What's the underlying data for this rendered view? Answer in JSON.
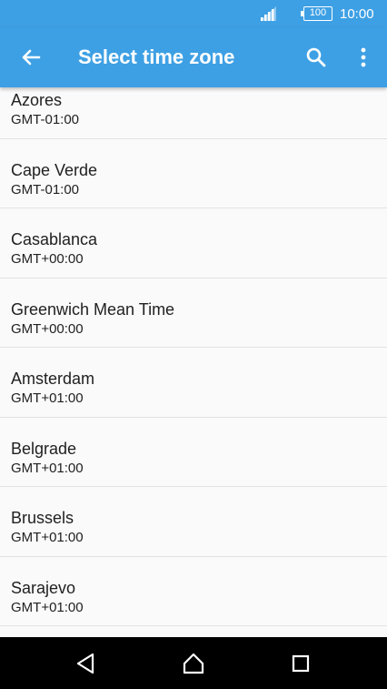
{
  "status_bar": {
    "signal_icon": "signal-icon",
    "battery_level": "100",
    "time": "10:00"
  },
  "app_bar": {
    "title": "Select time zone",
    "back_icon": "arrow-left-icon",
    "search_icon": "search-icon",
    "more_icon": "more-vertical-icon",
    "color": "#3ea0e4"
  },
  "time_zones": [
    {
      "name": "Azores",
      "offset": "GMT-01:00"
    },
    {
      "name": "Cape Verde",
      "offset": "GMT-01:00"
    },
    {
      "name": "Casablanca",
      "offset": "GMT+00:00"
    },
    {
      "name": "Greenwich Mean Time",
      "offset": "GMT+00:00"
    },
    {
      "name": "Amsterdam",
      "offset": "GMT+01:00"
    },
    {
      "name": "Belgrade",
      "offset": "GMT+01:00"
    },
    {
      "name": "Brussels",
      "offset": "GMT+01:00"
    },
    {
      "name": "Sarajevo",
      "offset": "GMT+01:00"
    }
  ],
  "nav_bar": {
    "back_icon": "nav-back-icon",
    "home_icon": "nav-home-icon",
    "recents_icon": "nav-recents-icon"
  }
}
